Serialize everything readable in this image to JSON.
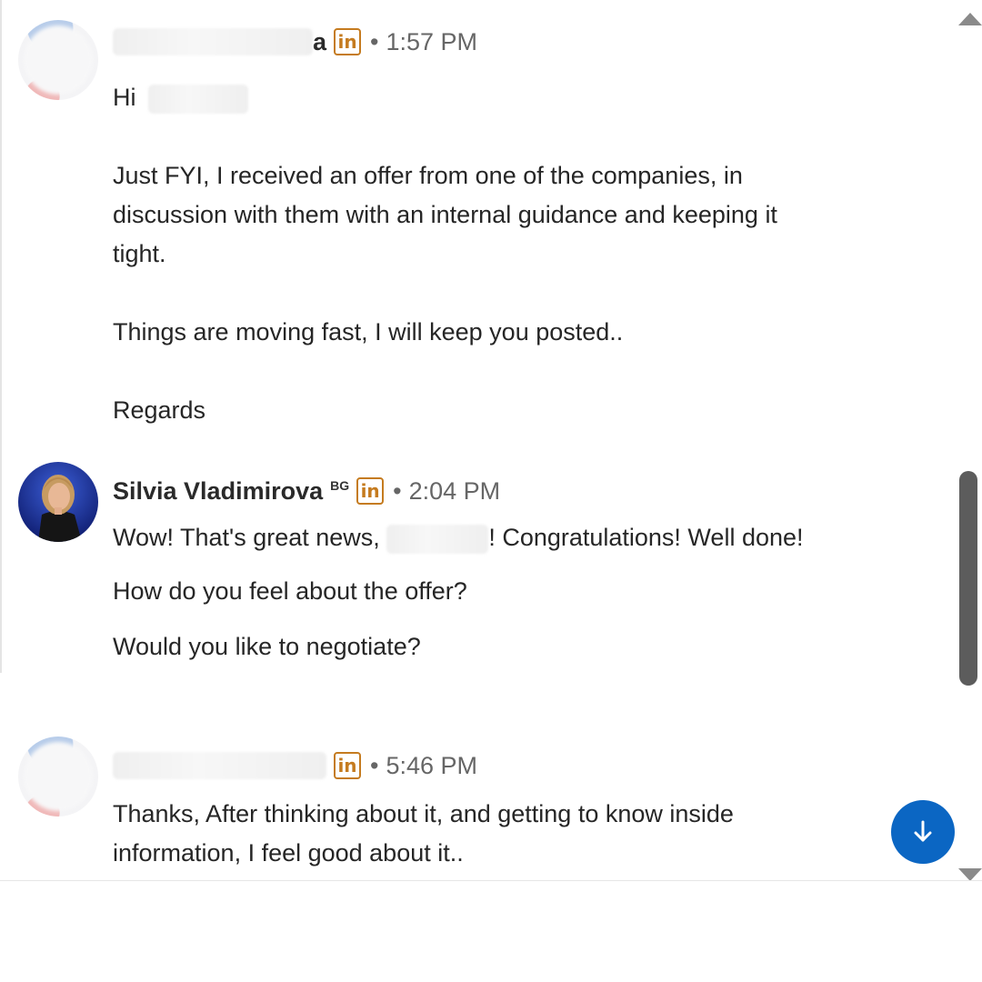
{
  "messages": [
    {
      "sender_visible": "a",
      "time": "1:57 PM",
      "lines": [
        "Hi"
      ],
      "paragraphs": [
        "Just FYI, I received an offer from one of the companies, in discussion with them with an internal guidance and keeping it tight.",
        "Things are moving fast, I will keep you posted..",
        "Regards"
      ]
    },
    {
      "sender": "Silvia Vladimirova",
      "sender_badge": "BG",
      "time": "2:04 PM",
      "line1_pre": "Wow! That's great news,",
      "line1_post": "! Congratulations! Well done!",
      "p2": "How do you feel about the offer?",
      "p3": "Would you like to negotiate?"
    },
    {
      "time": "5:46 PM",
      "p1": "Thanks, After thinking about it, and getting to know inside information, I feel good about it.."
    }
  ],
  "icons": {
    "linkedin": "in",
    "dot": "•",
    "jump_down": "arrow-down-icon"
  },
  "colors": {
    "linkedin_badge": "#c57b1f",
    "jump_button": "#0b66c3"
  }
}
